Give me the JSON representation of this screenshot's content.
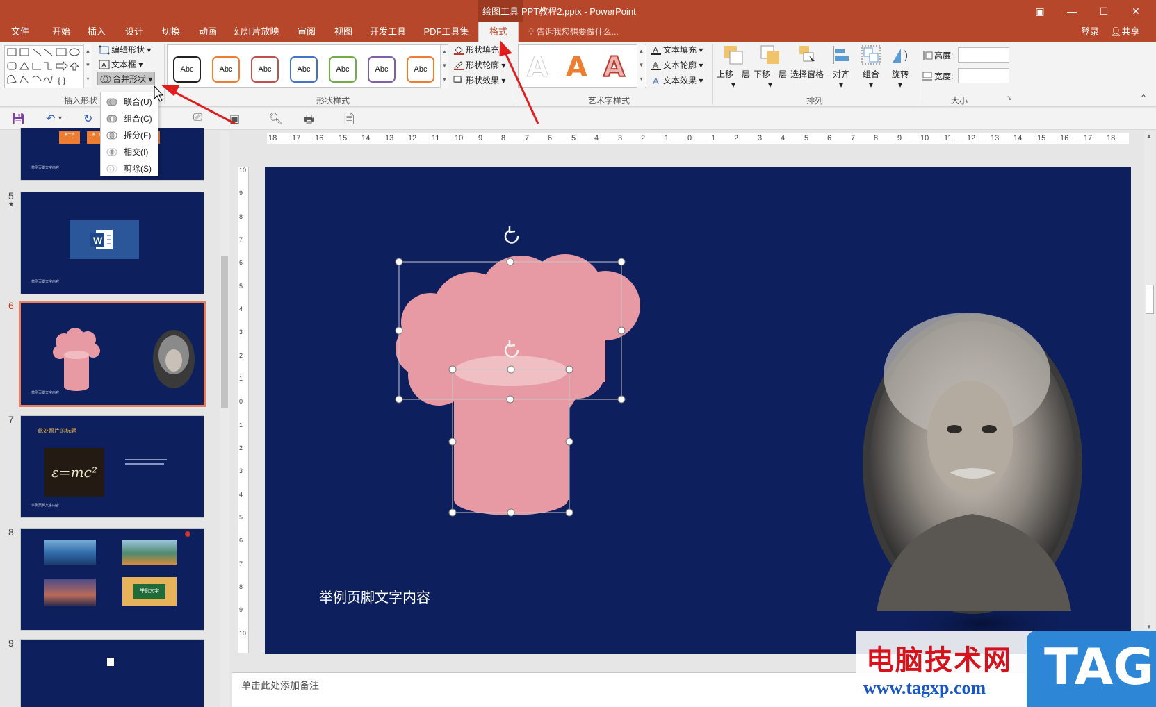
{
  "window": {
    "context_tab": "绘图工具",
    "doc_title": "PPT教程2.pptx - PowerPoint",
    "controls": [
      "▣",
      "—",
      "☐",
      "✕"
    ]
  },
  "tabs": [
    "文件",
    "开始",
    "插入",
    "设计",
    "切换",
    "动画",
    "幻灯片放映",
    "审阅",
    "视图",
    "开发工具",
    "PDF工具集",
    "格式"
  ],
  "active_tab": "格式",
  "tell_me": "告诉我您想要做什么...",
  "login": "登录",
  "share": "共享",
  "ribbon": {
    "insert_shapes": {
      "label": "插入形状",
      "edit_shape": "编辑形状",
      "text_box": "文本框",
      "merge_shapes": "合并形状"
    },
    "shape_styles": {
      "label": "形状样式",
      "samples": [
        "Abc",
        "Abc",
        "Abc",
        "Abc",
        "Abc",
        "Abc",
        "Abc"
      ],
      "sample_colors": [
        "#222222",
        "#ed7d31",
        "#c0504d",
        "#4472c4",
        "#70ad47",
        "#7f5fa8",
        "#ed7d31"
      ],
      "fill": "形状填充",
      "outline": "形状轮廓",
      "effects": "形状效果"
    },
    "wordart": {
      "label": "艺术字样式",
      "samples": [
        "A",
        "A",
        "A"
      ],
      "fill": "文本填充",
      "outline": "文本轮廓",
      "effects": "文本效果"
    },
    "arrange": {
      "label": "排列",
      "bring_forward": "上移一层",
      "send_backward": "下移一层",
      "selection_pane": "选择窗格",
      "align": "对齐",
      "group": "组合",
      "rotate": "旋转"
    },
    "size": {
      "label": "大小",
      "height": "高度:",
      "width": "宽度:"
    }
  },
  "merge_menu": [
    "联合(U)",
    "组合(C)",
    "拆分(F)",
    "相交(I)",
    "剪除(S)"
  ],
  "thumbnails": [
    {
      "number": "",
      "footer": "举例页脚文字内容"
    },
    {
      "number": "5",
      "star": "★",
      "footer": "举例页脚文字内容"
    },
    {
      "number": "6",
      "footer": "举例页脚文字内容"
    },
    {
      "number": "7",
      "title": "此处照片的标题",
      "formula": "ε=mc²",
      "footer": "举例页脚文字内容"
    },
    {
      "number": "8",
      "caption": "举例文字"
    },
    {
      "number": "9"
    }
  ],
  "thumb4_mini": [
    "第一步",
    "第二步"
  ],
  "ruler_h": [
    "18",
    "17",
    "16",
    "15",
    "14",
    "13",
    "12",
    "11",
    "10",
    "9",
    "8",
    "7",
    "6",
    "5",
    "4",
    "3",
    "2",
    "1",
    "0",
    "1",
    "2",
    "3",
    "4",
    "5",
    "6",
    "7",
    "8",
    "9",
    "10",
    "11",
    "12",
    "13",
    "14",
    "15",
    "16",
    "17",
    "18"
  ],
  "ruler_v": [
    "10",
    "9",
    "8",
    "7",
    "6",
    "5",
    "4",
    "3",
    "2",
    "1",
    "0",
    "1",
    "2",
    "3",
    "4",
    "5",
    "6",
    "7",
    "8",
    "9",
    "10"
  ],
  "slide": {
    "footer": "举例页脚文字内容",
    "shape_color": "#e89aa4",
    "background": "#0d1f5c"
  },
  "notes_placeholder": "单击此处添加备注",
  "watermark": {
    "cn": "电脑技术网",
    "url": "www.tagxp.com",
    "tag": "TAG"
  }
}
